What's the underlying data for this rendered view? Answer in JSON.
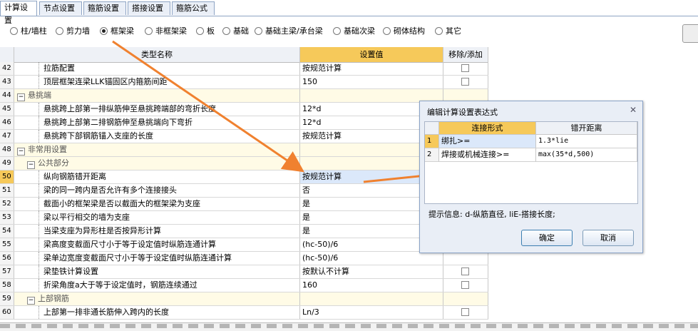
{
  "tabs": [
    {
      "label": "计算设置",
      "active": true
    },
    {
      "label": "节点设置",
      "active": false
    },
    {
      "label": "箍筋设置",
      "active": false
    },
    {
      "label": "搭接设置",
      "active": false
    },
    {
      "label": "箍筋公式",
      "active": false
    }
  ],
  "radios": [
    {
      "label": "柱/墙柱",
      "checked": false
    },
    {
      "label": "剪力墙",
      "checked": false
    },
    {
      "label": "框架梁",
      "checked": true
    },
    {
      "label": "非框架梁",
      "checked": false
    },
    {
      "label": "板",
      "checked": false
    },
    {
      "label": "基础",
      "checked": false
    },
    {
      "label": "基础主梁/承台梁",
      "checked": false
    },
    {
      "label": "基础次梁",
      "checked": false
    },
    {
      "label": "砌体结构",
      "checked": false
    },
    {
      "label": "其它",
      "checked": false
    }
  ],
  "grid": {
    "headers": {
      "name": "类型名称",
      "value": "设置值",
      "toggle": "移除/添加"
    },
    "rows": [
      {
        "num": "42",
        "name": "拉筋配置",
        "value": "按规范计算",
        "check": true
      },
      {
        "num": "43",
        "name": "顶层框架连梁LLK锚固区内箍筋间距",
        "value": "150",
        "check": true
      },
      {
        "num": "44",
        "name": "悬挑端",
        "value": "",
        "check": false,
        "group": true
      },
      {
        "num": "45",
        "name": "悬挑跨上部第一排纵筋伸至悬挑跨端部的弯折长度",
        "value": "12*d",
        "check": false
      },
      {
        "num": "46",
        "name": "悬挑跨上部第二排钢筋伸至悬挑端向下弯折",
        "value": "12*d",
        "check": false
      },
      {
        "num": "47",
        "name": "悬挑跨下部钢筋锚入支座的长度",
        "value": "按规范计算",
        "check": false
      },
      {
        "num": "48",
        "name": "非常用设置",
        "value": "",
        "check": false,
        "group": true
      },
      {
        "num": "49",
        "name": "公共部分",
        "value": "",
        "check": false,
        "group": true,
        "sub": true
      },
      {
        "num": "50",
        "name": "纵向钢筋错开距离",
        "value": "按规范计算",
        "check": false,
        "selected": true
      },
      {
        "num": "51",
        "name": "梁的同一跨内是否允许有多个连接接头",
        "value": "否",
        "check": false
      },
      {
        "num": "52",
        "name": "截面小的框架梁是否以截面大的框架梁为支座",
        "value": "是",
        "check": false
      },
      {
        "num": "53",
        "name": "梁以平行相交的墙为支座",
        "value": "是",
        "check": false
      },
      {
        "num": "54",
        "name": "当梁支座为异形柱是否按异形计算",
        "value": "是",
        "check": false
      },
      {
        "num": "55",
        "name": "梁高度变截面尺寸小于等于设定值时纵筋连通计算",
        "value": "(hc-50)/6",
        "check": false
      },
      {
        "num": "56",
        "name": "梁单边宽度变截面尺寸小于等于设定值时纵筋连通计算",
        "value": "(hc-50)/6",
        "check": false
      },
      {
        "num": "57",
        "name": "梁垫铁计算设置",
        "value": "按默认不计算",
        "check": true
      },
      {
        "num": "58",
        "name": "折梁角度a大于等于设定值时，钢筋连续通过",
        "value": "160",
        "check": true
      },
      {
        "num": "59",
        "name": "上部钢筋",
        "value": "",
        "check": false,
        "group": true,
        "sub": true
      },
      {
        "num": "60",
        "name": "上部第一排非通长筋伸入跨内的长度",
        "value": "Ln/3",
        "check": true
      }
    ]
  },
  "dialog": {
    "title": "编辑计算设置表达式",
    "close": "✕",
    "headers": {
      "type": "连接形式",
      "dist": "错开距离"
    },
    "rows": [
      {
        "num": "1",
        "type": "绑扎>=",
        "dist": "1.3*lie"
      },
      {
        "num": "2",
        "type": "焊接或机械连接>=",
        "dist": "max(35*d,500)"
      }
    ],
    "hint": "提示信息: d-纵筋直径, liE-搭接长度;",
    "ok": "确定",
    "cancel": "取消"
  },
  "colors": {
    "accent": "#f0812f",
    "header_highlight": "#f6c95a"
  }
}
